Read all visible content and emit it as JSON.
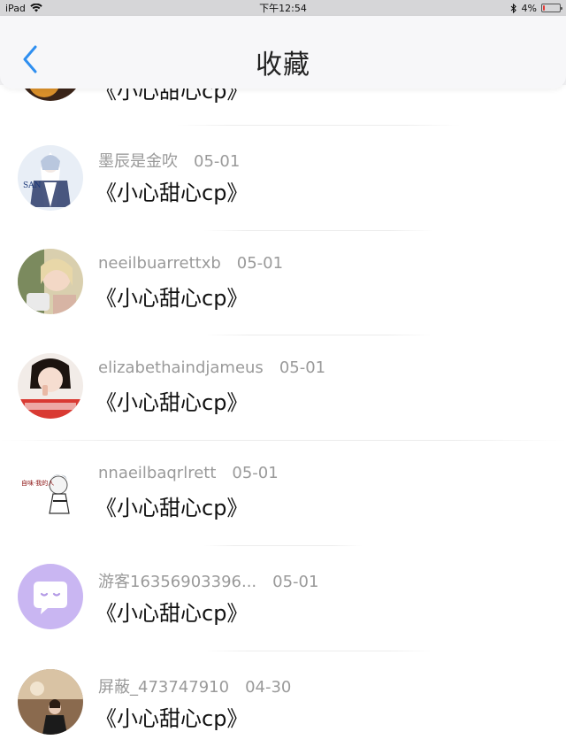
{
  "status_bar": {
    "device": "iPad",
    "time": "下午12:54",
    "battery": "4%"
  },
  "header": {
    "title": "收藏",
    "back_icon": "chevron-left-icon"
  },
  "partial_item": {
    "comment": "《小心甜心cp》"
  },
  "items": [
    {
      "username": "墨辰是金吹",
      "date": "05-01",
      "comment": "《小心甜心cp》",
      "avatar": "anime-character"
    },
    {
      "username": "neeilbuarrettxb",
      "date": "05-01",
      "comment": "《小心甜心cp》",
      "avatar": "photo"
    },
    {
      "username": "elizabethaindjameus",
      "date": "05-01",
      "comment": "《小心甜心cp》",
      "avatar": "selfie"
    },
    {
      "username": "nnaeilbaqrlrett",
      "date": "05-01",
      "comment": "《小心甜心cp》",
      "avatar": "chibi-drawing"
    },
    {
      "username": "游客16356903396...",
      "date": "05-01",
      "comment": "《小心甜心cp》",
      "avatar": "default-chat-bubble"
    },
    {
      "username": "屏蔽_473747910",
      "date": "04-30",
      "comment": "《小心甜心cp》",
      "avatar": "photo"
    }
  ],
  "colors": {
    "accent": "#2f8ff0",
    "default_avatar_bg": "#c9b6f2"
  }
}
